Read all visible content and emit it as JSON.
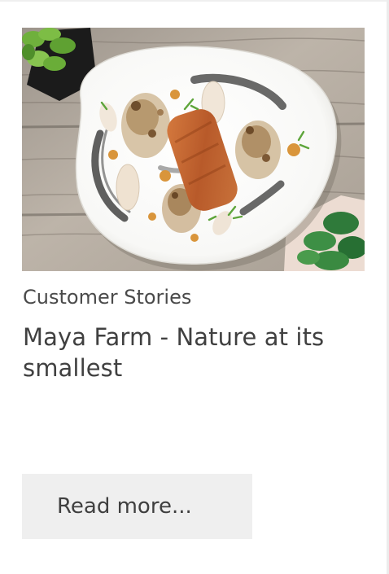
{
  "card": {
    "image_alt": "Plated salmon with roasted cauliflower on a white dish",
    "category": "Customer Stories",
    "title": "Maya Farm - Nature at its smallest",
    "read_more": "Read more..."
  }
}
